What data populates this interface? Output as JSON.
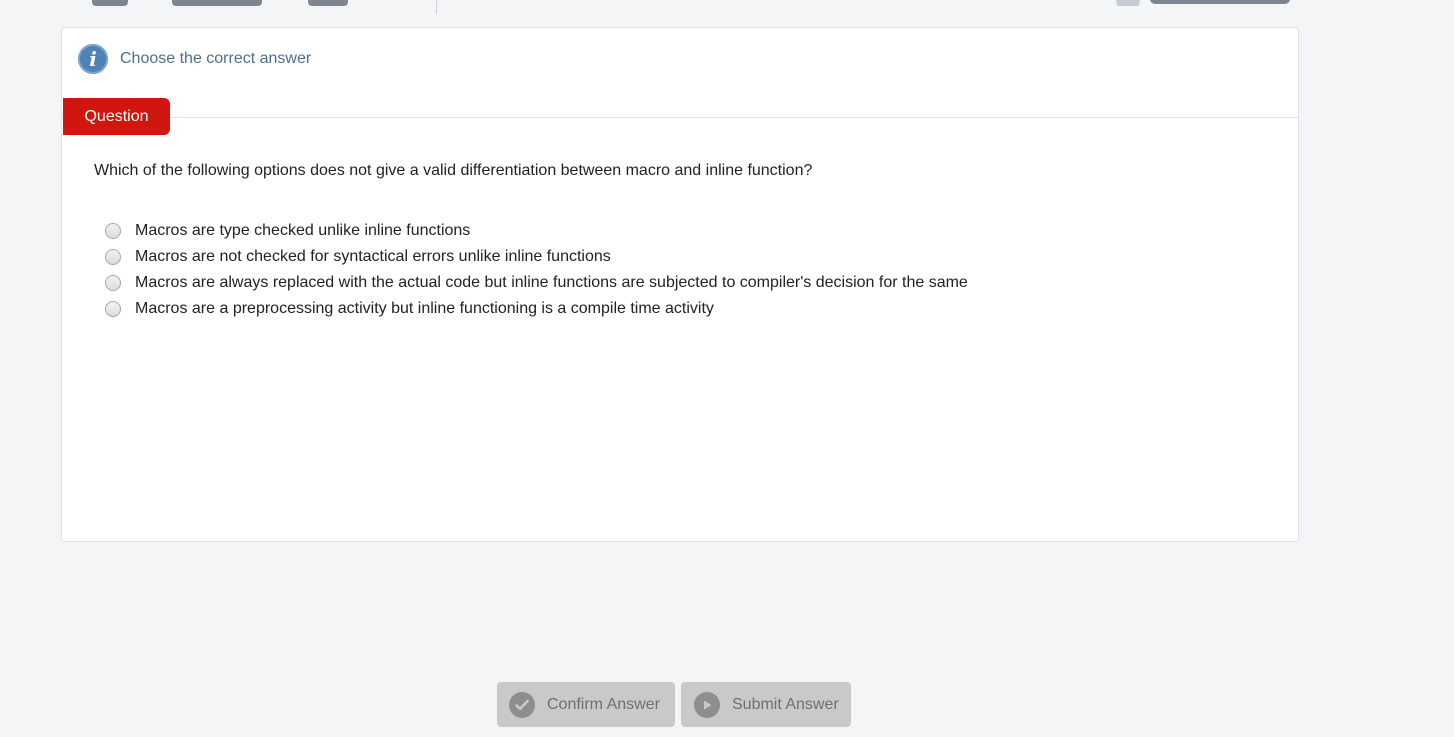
{
  "instruction": {
    "icon": "info-icon",
    "text": "Choose the correct answer"
  },
  "question": {
    "tab_label": "Question",
    "text": "Which of the following options does not give a valid differentiation between macro and inline function?",
    "options": [
      "Macros are type checked unlike inline functions",
      "Macros are not checked for syntactical errors unlike inline functions",
      "Macros are always replaced with the actual code but inline functions are subjected to compiler's decision for the same",
      "Macros are a preprocessing activity but inline functioning is a compile time activity"
    ]
  },
  "actions": {
    "confirm_label": "Confirm Answer",
    "submit_label": "Submit Answer"
  },
  "colors": {
    "accent": "#d0160f",
    "info": "#4e82b8",
    "disabled_button": "#c9c9c9"
  }
}
